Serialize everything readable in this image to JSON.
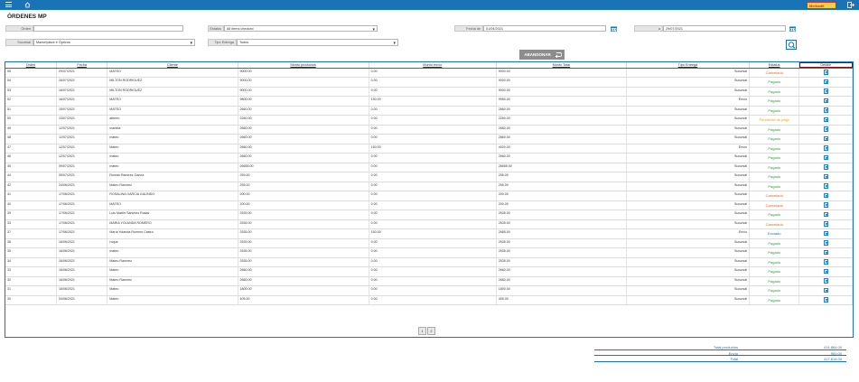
{
  "header": {
    "logo_text": "Merkadit"
  },
  "page_title": "ÓRDENES MP",
  "filters": {
    "orden_label": "Orden",
    "orden_value": "",
    "estatus_label": "Estatus",
    "estatus_value": "All items checked",
    "fecha_de_label": "Fecha de",
    "fecha_de_value": "01/04/2021",
    "fecha_a_label": "a",
    "fecha_a_value": "29/07/2021",
    "sucursal_label": "Sucursal",
    "sucursal_value": "Marketplace e Ópticos",
    "tipo_entrega_label": "Tipo Entrega",
    "tipo_entrega_value": "Todos"
  },
  "abandon_button": "ABANDONAR",
  "columns": [
    "Orden",
    "Fecha",
    "Cliente",
    "Monto productos",
    "Monto envío",
    "Monto Total",
    "Tipo Entrega",
    "Estatus",
    "Detalle"
  ],
  "rows": [
    [
      "55",
      "29/07/2021",
      "MATEO",
      "9000.00",
      "0.00",
      "9000.00",
      "Sucursal",
      "Cancelado"
    ],
    [
      "54",
      "16/07/2021",
      "MILTON RODRIGUEZ",
      "9000.00",
      "0.00",
      "9000.00",
      "Sucursal",
      "Pagado"
    ],
    [
      "53",
      "16/07/2021",
      "MILTON RODRIGUEZ",
      "9000.00",
      "0.00",
      "9000.00",
      "Sucursal",
      "Pagado"
    ],
    [
      "52",
      "16/07/2021",
      "MATEO",
      "9800.00",
      "150.00",
      "9950.00",
      "Envío",
      "Pagado"
    ],
    [
      "51",
      "15/07/2021",
      "MATEO",
      "2660.00",
      "0.00",
      "2660.00",
      "Sucursal",
      "Pagado"
    ],
    [
      "50",
      "13/07/2021",
      "alberto",
      "2260.00",
      "0.00",
      "2260.00",
      "Sucursal",
      "Pendiente de pago"
    ],
    [
      "49",
      "12/07/2021",
      "marleta",
      "2660.00",
      "0.00",
      "2660.00",
      "Sucursal",
      "Pagado"
    ],
    [
      "48",
      "12/07/2021",
      "mateo",
      "2660.00",
      "0.00",
      "2660.00",
      "Sucursal",
      "Pagado"
    ],
    [
      "47",
      "12/07/2021",
      "Mateo",
      "2660.00",
      "150.00",
      "4020.00",
      "Envío",
      "Pagado"
    ],
    [
      "46",
      "12/07/2021",
      "mateo",
      "2660.00",
      "0.00",
      "2660.00",
      "Sucursal",
      "Pagado"
    ],
    [
      "45",
      "09/07/2021",
      "mateo",
      "26655.00",
      "0.00",
      "26655.00",
      "Sucursal",
      "Pagado"
    ],
    [
      "44",
      "05/07/2021",
      "Román Ramírez García",
      "255.00",
      "0.00",
      "255.00",
      "Sucursal",
      "Pagado"
    ],
    [
      "42",
      "24/06/2021",
      "Mateo Ramírez",
      "255.00",
      "0.00",
      "255.00",
      "Sucursal",
      "Pagado"
    ],
    [
      "41",
      "17/06/2021",
      "ROSALINA GARCIA GALINDO",
      "200.00",
      "0.00",
      "200.00",
      "Sucursal",
      "Cancelado"
    ],
    [
      "40",
      "17/06/2021",
      "MATEO",
      "200.00",
      "0.00",
      "200.00",
      "Sucursal",
      "Cancelado"
    ],
    [
      "39",
      "17/06/2021",
      "Luis Martín Sánchez Rosas",
      "2535.00",
      "0.00",
      "2535.00",
      "Sucursal",
      "Pagado"
    ],
    [
      "33",
      "17/06/2021",
      "MARIA YOLANDA ROMERO",
      "2535.00",
      "0.00",
      "2535.00",
      "Sucursal",
      "Cancelado"
    ],
    [
      "37",
      "17/06/2021",
      "María Yolanda Romero Castro",
      "2535.00",
      "150.00",
      "2685.00",
      "Envío",
      "Enviado"
    ],
    [
      "36",
      "16/06/2021",
      "roque",
      "2535.00",
      "0.00",
      "2535.00",
      "Sucursal",
      "Pagado"
    ],
    [
      "35",
      "16/06/2021",
      "mateo",
      "2535.00",
      "0.00",
      "2535.00",
      "Sucursal",
      "Pagado"
    ],
    [
      "34",
      "16/06/2021",
      "Mateo Ramírez",
      "2535.00",
      "0.00",
      "2535.00",
      "Sucursal",
      "Pagado"
    ],
    [
      "33",
      "16/06/2021",
      "Mateo",
      "2660.00",
      "0.00",
      "2660.00",
      "Sucursal",
      "Pagado"
    ],
    [
      "32",
      "16/06/2021",
      "Mateo Ramírez",
      "2660.00",
      "0.00",
      "2660.00",
      "Sucursal",
      "Pagado"
    ],
    [
      "31",
      "16/06/2021",
      "Mateo",
      "1800.00",
      "0.00",
      "1800.00",
      "Sucursal",
      "Pagado"
    ],
    [
      "30",
      "04/06/2021",
      "Mateo",
      "405.00",
      "0.00",
      "405.00",
      "Sucursal",
      "Pagado"
    ]
  ],
  "status_colors": {
    "Cancelado": "#e8641b",
    "Pagado": "#2e9e3c",
    "Pendiente de pago": "#f0a500",
    "Enviado": "#1a73b6"
  },
  "pager": {
    "page1": "1",
    "page2": "2"
  },
  "totals": {
    "productos_label": "Total productos",
    "productos_value": "414,864.00",
    "envio_label": "Envío",
    "envio_value": "900.00",
    "total_label": "Total",
    "total_value": "417,814.00"
  }
}
